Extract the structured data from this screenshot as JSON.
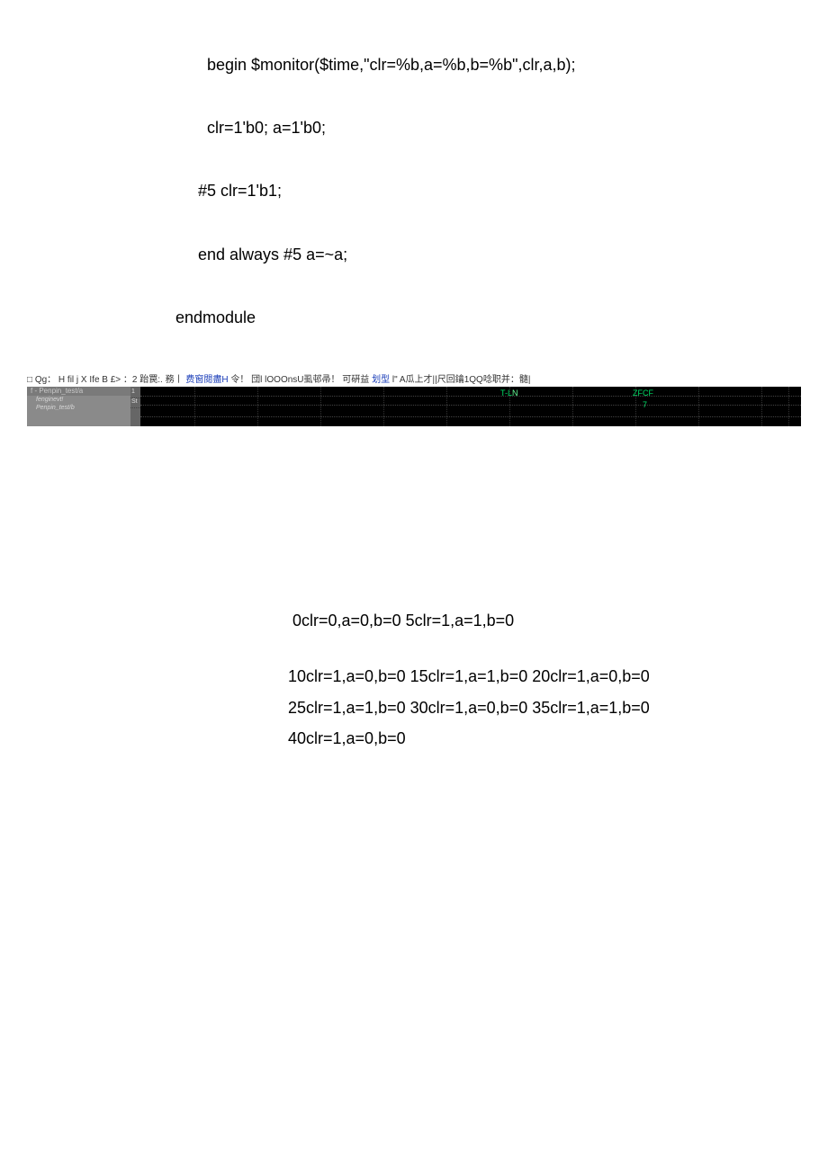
{
  "code": {
    "line1": "begin $monitor($time,\"clr=%b,a=%b,b=%b\",clr,a,b);",
    "line2": "clr=1'b0; a=1'b0;",
    "line3": "#5 clr=1'b1;",
    "line4": "end always #5 a=~a;",
    "line5": "endmodule"
  },
  "waveform": {
    "menu_prefix": "□ Qg： H fil j X Ife B £> ：2 跆罠:. 務丨",
    "menu_part1": "费窗閱盡H",
    "menu_part2": "令！ 団l lOOOnsU虱邨帚！ 可硏益",
    "menu_part3": "划型",
    "menu_part4": "l\" A瓜上才||尺回鑰1QQ唸职并：髓|",
    "signal_header": "f - Penpin_test/a",
    "signal1": "fenginevt!",
    "signal2": "Penpin_test/b",
    "value1": "1",
    "value2": "St",
    "label1": "T-L",
    "label1_suffix": "N",
    "label2": "ZFCF",
    "label3": "7"
  },
  "output": {
    "line1": "0clr=0,a=0,b=0 5clr=1,a=1,b=0",
    "line2": "10clr=1,a=0,b=0 15clr=1,a=1,b=0 20clr=1,a=0,b=0",
    "line3": "25clr=1,a=1,b=0 30clr=1,a=0,b=0 35clr=1,a=1,b=0",
    "line4": "40clr=1,a=0,b=0"
  }
}
